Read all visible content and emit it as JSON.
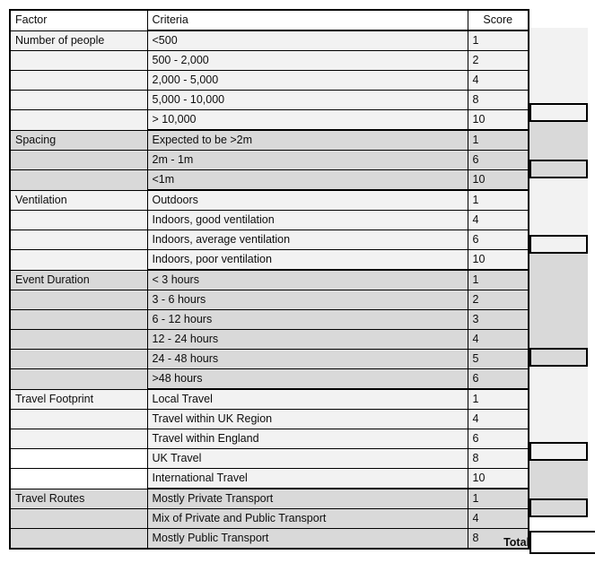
{
  "table": {
    "headers": {
      "factor": "Factor",
      "criteria": "Criteria",
      "score": "Score",
      "entry": ""
    },
    "groups": [
      {
        "factor": "Number of people",
        "shade": "#f2f2f2",
        "shade_name": "light",
        "split_after": 0,
        "rows": [
          {
            "criteria": "<500",
            "score": "1"
          },
          {
            "criteria": "500 - 2,000",
            "score": "2"
          },
          {
            "criteria": "2,000 - 5,000",
            "score": "4"
          },
          {
            "criteria": "5,000 - 10,000",
            "score": "8"
          },
          {
            "criteria": "> 10,000",
            "score": "10"
          }
        ]
      },
      {
        "factor": "Spacing",
        "shade": "#d9d9d9",
        "shade_name": "dark",
        "split_after": 0,
        "rows": [
          {
            "criteria": "Expected to be >2m",
            "score": "1"
          },
          {
            "criteria": "2m - 1m",
            "score": "6"
          },
          {
            "criteria": "<1m",
            "score": "10"
          }
        ]
      },
      {
        "factor": "Ventilation",
        "shade": "#f2f2f2",
        "shade_name": "light",
        "split_after": 0,
        "rows": [
          {
            "criteria": "Outdoors",
            "score": "1"
          },
          {
            "criteria": "Indoors, good ventilation",
            "score": "4"
          },
          {
            "criteria": "Indoors, average ventilation",
            "score": "6"
          },
          {
            "criteria": "Indoors, poor ventilation",
            "score": "10"
          }
        ]
      },
      {
        "factor": "Event Duration",
        "shade": "#d9d9d9",
        "shade_name": "dark",
        "split_after": 3,
        "rows": [
          {
            "criteria": "< 3 hours",
            "score": "1"
          },
          {
            "criteria": "3 - 6 hours",
            "score": "2"
          },
          {
            "criteria": "6 - 12 hours",
            "score": "3"
          },
          {
            "criteria": "12 - 24 hours",
            "score": "4"
          },
          {
            "criteria": "24 - 48 hours",
            "score": "5"
          },
          {
            "criteria": ">48 hours",
            "score": "6"
          }
        ]
      },
      {
        "factor": "Travel Footprint",
        "shade": "#f2f2f2",
        "shade_name": "light",
        "split_after": 3,
        "split_white_factor": true,
        "rows": [
          {
            "criteria": "Local Travel",
            "score": "1"
          },
          {
            "criteria": "Travel within UK Region",
            "score": "4"
          },
          {
            "criteria": "Travel within England",
            "score": "6"
          },
          {
            "criteria": "UK Travel",
            "score": "8"
          },
          {
            "criteria": "International Travel",
            "score": "10"
          }
        ]
      },
      {
        "factor": "Travel Routes",
        "shade": "#d9d9d9",
        "shade_name": "dark",
        "split_after": 0,
        "rows": [
          {
            "criteria": "Mostly Private Transport",
            "score": "1"
          },
          {
            "criteria": "Mix of Private and Public Transport",
            "score": "4"
          },
          {
            "criteria": "Mostly Public Transport",
            "score": "8"
          }
        ]
      }
    ],
    "total": {
      "label": "Total",
      "value": ""
    }
  },
  "colors": {
    "band_light": "#f2f2f2",
    "band_dark": "#d9d9d9",
    "grid": "#000000",
    "text": "#0d0d0d",
    "page_background": "#ffffff"
  }
}
